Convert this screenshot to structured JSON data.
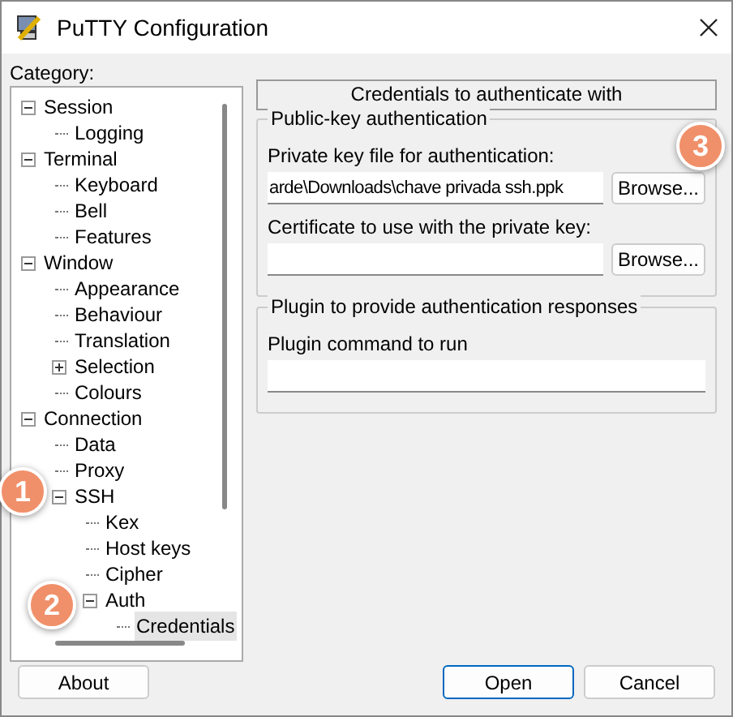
{
  "window": {
    "title": "PuTTY Configuration"
  },
  "category_label": "Category:",
  "tree": [
    {
      "label": "Session",
      "expanded": true,
      "selected": false,
      "children": [
        {
          "label": "Logging",
          "selected": false
        }
      ]
    },
    {
      "label": "Terminal",
      "expanded": true,
      "selected": false,
      "children": [
        {
          "label": "Keyboard",
          "selected": false
        },
        {
          "label": "Bell",
          "selected": false
        },
        {
          "label": "Features",
          "selected": false
        }
      ]
    },
    {
      "label": "Window",
      "expanded": true,
      "selected": false,
      "children": [
        {
          "label": "Appearance",
          "selected": false
        },
        {
          "label": "Behaviour",
          "selected": false
        },
        {
          "label": "Translation",
          "selected": false
        },
        {
          "label": "Selection",
          "expanded": false,
          "selected": false
        },
        {
          "label": "Colours",
          "selected": false
        }
      ]
    },
    {
      "label": "Connection",
      "expanded": true,
      "selected": false,
      "children": [
        {
          "label": "Data",
          "selected": false
        },
        {
          "label": "Proxy",
          "selected": false
        },
        {
          "label": "SSH",
          "expanded": true,
          "selected": false,
          "children": [
            {
              "label": "Kex",
              "selected": false
            },
            {
              "label": "Host keys",
              "selected": false
            },
            {
              "label": "Cipher",
              "selected": false
            },
            {
              "label": "Auth",
              "expanded": true,
              "selected": false,
              "children": [
                {
                  "label": "Credentials",
                  "selected": true
                }
              ]
            }
          ]
        }
      ]
    }
  ],
  "panel_title": "Credentials to authenticate with",
  "groups": [
    {
      "title": "Public-key authentication",
      "fields": [
        {
          "label": "Private key file for authentication:",
          "value": "arde\\Downloads\\chave privada ssh.ppk",
          "button": "Browse..."
        },
        {
          "label": "Certificate to use with the private key:",
          "button": "Browse..."
        }
      ]
    },
    {
      "title": "Plugin to provide authentication responses",
      "fields": [
        {
          "label": "Plugin command to run"
        }
      ]
    }
  ],
  "buttons": [
    {
      "label": "About"
    },
    {
      "label": "Open",
      "default": true
    },
    {
      "label": "Cancel",
      "default": false
    }
  ],
  "badges": [
    {
      "text": "1"
    },
    {
      "text": "2"
    },
    {
      "text": "3"
    }
  ]
}
